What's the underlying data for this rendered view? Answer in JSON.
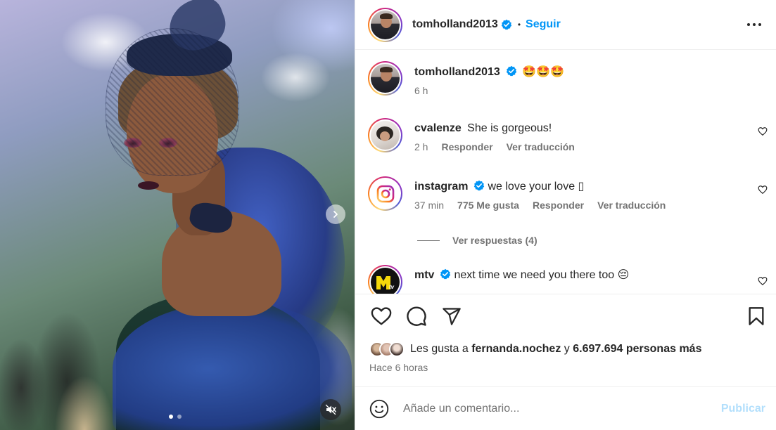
{
  "post": {
    "author": "tomholland2013",
    "separator": "•",
    "follow_label": "Seguir",
    "caption": {
      "author": "tomholland2013",
      "text": "🤩🤩🤩",
      "time": "6 h"
    },
    "media": {
      "slide_count": 2,
      "active_slide": 0
    }
  },
  "comments": [
    {
      "author": "cvalenze",
      "verified": false,
      "text": "She is gorgeous!",
      "time": "2 h",
      "likes": "",
      "reply_label": "Responder",
      "translate_label": "Ver traducción"
    },
    {
      "author": "instagram",
      "verified": true,
      "text": "we love your love ▯",
      "time": "37 min",
      "likes": "775 Me gusta",
      "reply_label": "Responder",
      "translate_label": "Ver traducción",
      "view_replies": "Ver respuestas (4)"
    },
    {
      "author": "mtv",
      "verified": true,
      "text": "next time we need you there too 😔"
    }
  ],
  "likes": {
    "prefix": "Les gusta a",
    "first_user": "fernanda.nochez",
    "connector": "y",
    "others": "6.697.694 personas más",
    "time_ago": "Hace 6 horas"
  },
  "composer": {
    "placeholder": "Añade un comentario...",
    "publish_label": "Publicar"
  },
  "colors": {
    "accent": "#0095f6",
    "publish_disabled": "#b2dffc",
    "verified": "#0095f6",
    "meta_text": "#737373"
  },
  "icons": [
    "more-options-icon",
    "verified-badge-icon",
    "heart-icon",
    "comment-icon",
    "share-icon",
    "bookmark-icon",
    "emoji-icon",
    "mute-icon",
    "chevron-right-icon"
  ]
}
